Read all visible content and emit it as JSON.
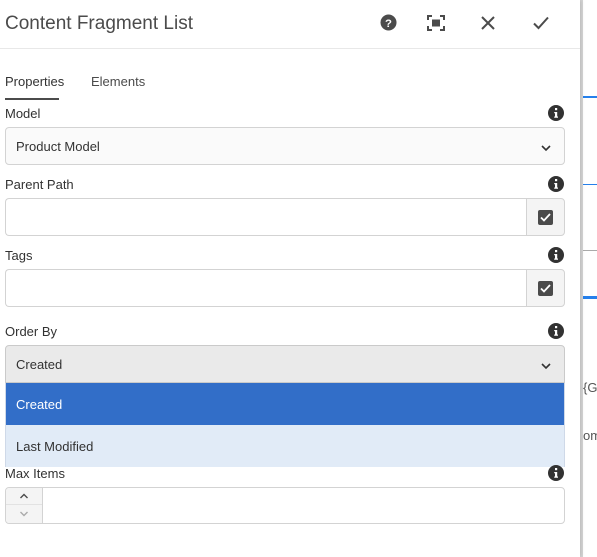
{
  "dialog": {
    "title": "Content Fragment List",
    "header_icons": [
      "help-icon",
      "fullscreen-icon",
      "close-icon",
      "done-icon"
    ]
  },
  "tabs": [
    {
      "label": "Properties",
      "active": true
    },
    {
      "label": "Elements",
      "active": false
    }
  ],
  "fields": {
    "model": {
      "label": "Model",
      "value": "Product Model"
    },
    "parent_path": {
      "label": "Parent Path",
      "value": ""
    },
    "tags": {
      "label": "Tags",
      "value": ""
    },
    "order_by": {
      "label": "Order By",
      "value": "Created",
      "options": [
        "Created",
        "Last Modified"
      ],
      "selected_index": 0
    },
    "max_items": {
      "label": "Max Items",
      "value": ""
    }
  },
  "background": {
    "text_fragments": [
      "{Ge",
      "omn"
    ],
    "accent_color": "#2680eb"
  },
  "colors": {
    "selected_option": "#326ec8",
    "dropdown_bg": "#e1ebf7",
    "info_icon": "#323232"
  }
}
